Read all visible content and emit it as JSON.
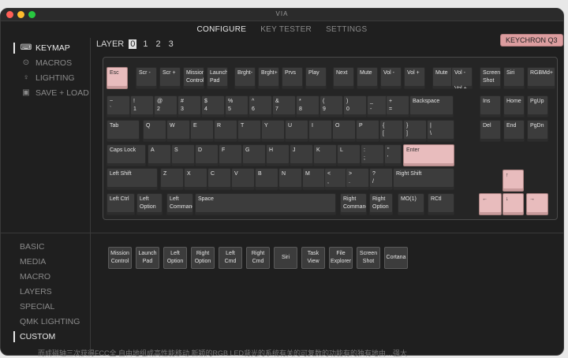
{
  "app": {
    "title": "VIA",
    "colors": {
      "accent": "#e8bcbd",
      "close": "#ff5f57",
      "minimize": "#febc2e",
      "maximize": "#28c840"
    }
  },
  "topnav": {
    "tabs": [
      {
        "label": "CONFIGURE",
        "active": true
      },
      {
        "label": "KEY TESTER",
        "active": false
      },
      {
        "label": "SETTINGS",
        "active": false
      }
    ]
  },
  "sidebar": {
    "items": [
      {
        "label": "KEYMAP",
        "icon": "keyboard-icon",
        "glyph": "⌨",
        "active": true
      },
      {
        "label": "MACROS",
        "icon": "macro-icon",
        "glyph": "⊙",
        "active": false
      },
      {
        "label": "LIGHTING",
        "icon": "bulb-icon",
        "glyph": "♀",
        "active": false
      },
      {
        "label": "SAVE + LOAD",
        "icon": "save-icon",
        "glyph": "▣",
        "active": false
      }
    ]
  },
  "layers": {
    "label": "LAYER",
    "options": [
      "0",
      "1",
      "2",
      "3"
    ],
    "active": "0"
  },
  "keyboard_name": "KEYCHRON Q3",
  "keys": [
    "Esc",
    "Scr -",
    "Scr +",
    "Mission\nControl",
    "Launch\nPad",
    "Brght-",
    "Brght+",
    "Prvs",
    "Play",
    "Next",
    "Mute",
    "Vol -",
    "Vol +",
    "Mute",
    "Vol -\n\nVol +",
    "Screen\nShot",
    "Siri",
    "RGBMd+",
    "~\n`",
    "!\n1",
    "@\n2",
    "#\n3",
    "$\n4",
    "%\n5",
    "^\n6",
    "&\n7",
    "*\n8",
    "(\n9",
    ")\n0",
    "_\n-",
    "+\n=",
    "Backspace",
    "Ins",
    "Home",
    "PgUp",
    "Tab",
    "Q",
    "W",
    "E",
    "R",
    "T",
    "Y",
    "U",
    "I",
    "O",
    "P",
    "{\n[",
    "}\n]",
    "|\n\\",
    "Del",
    "End",
    "PgDn",
    "Caps Lock",
    "A",
    "S",
    "D",
    "F",
    "G",
    "H",
    "J",
    "K",
    "L",
    ":\n;",
    "\"\n'",
    "Enter",
    "Left Shift",
    "Z",
    "X",
    "C",
    "V",
    "B",
    "N",
    "M",
    "<\n,",
    ">\n.",
    "?\n/",
    "Right Shift",
    "↑",
    "Left Ctrl",
    "Left\nOption",
    "Left\nCommand",
    "Space",
    "Right\nCommand",
    "Right\nOption",
    "MO(1)",
    "RCtl",
    "←",
    "↓",
    "→"
  ],
  "categories": [
    {
      "label": "BASIC",
      "active": false
    },
    {
      "label": "MEDIA",
      "active": false
    },
    {
      "label": "MACRO",
      "active": false
    },
    {
      "label": "LAYERS",
      "active": false
    },
    {
      "label": "SPECIAL",
      "active": false
    },
    {
      "label": "QMK LIGHTING",
      "active": false
    },
    {
      "label": "CUSTOM",
      "active": true
    }
  ],
  "palette": [
    "Mission\nControl",
    "Launch\nPad",
    "Left\nOption",
    "Right\nOption",
    "Left\nCmd",
    "Right\nCmd",
    "Siri",
    "Task\nView",
    "File\nExplorer",
    "Screen\nShot",
    "Cortana"
  ],
  "background_text": "而成磁轴三次获得FCC全   自由地组成高性能移动        新颖的RGB LED背光的系统有关的可复数的功能有的独有地由…强大"
}
